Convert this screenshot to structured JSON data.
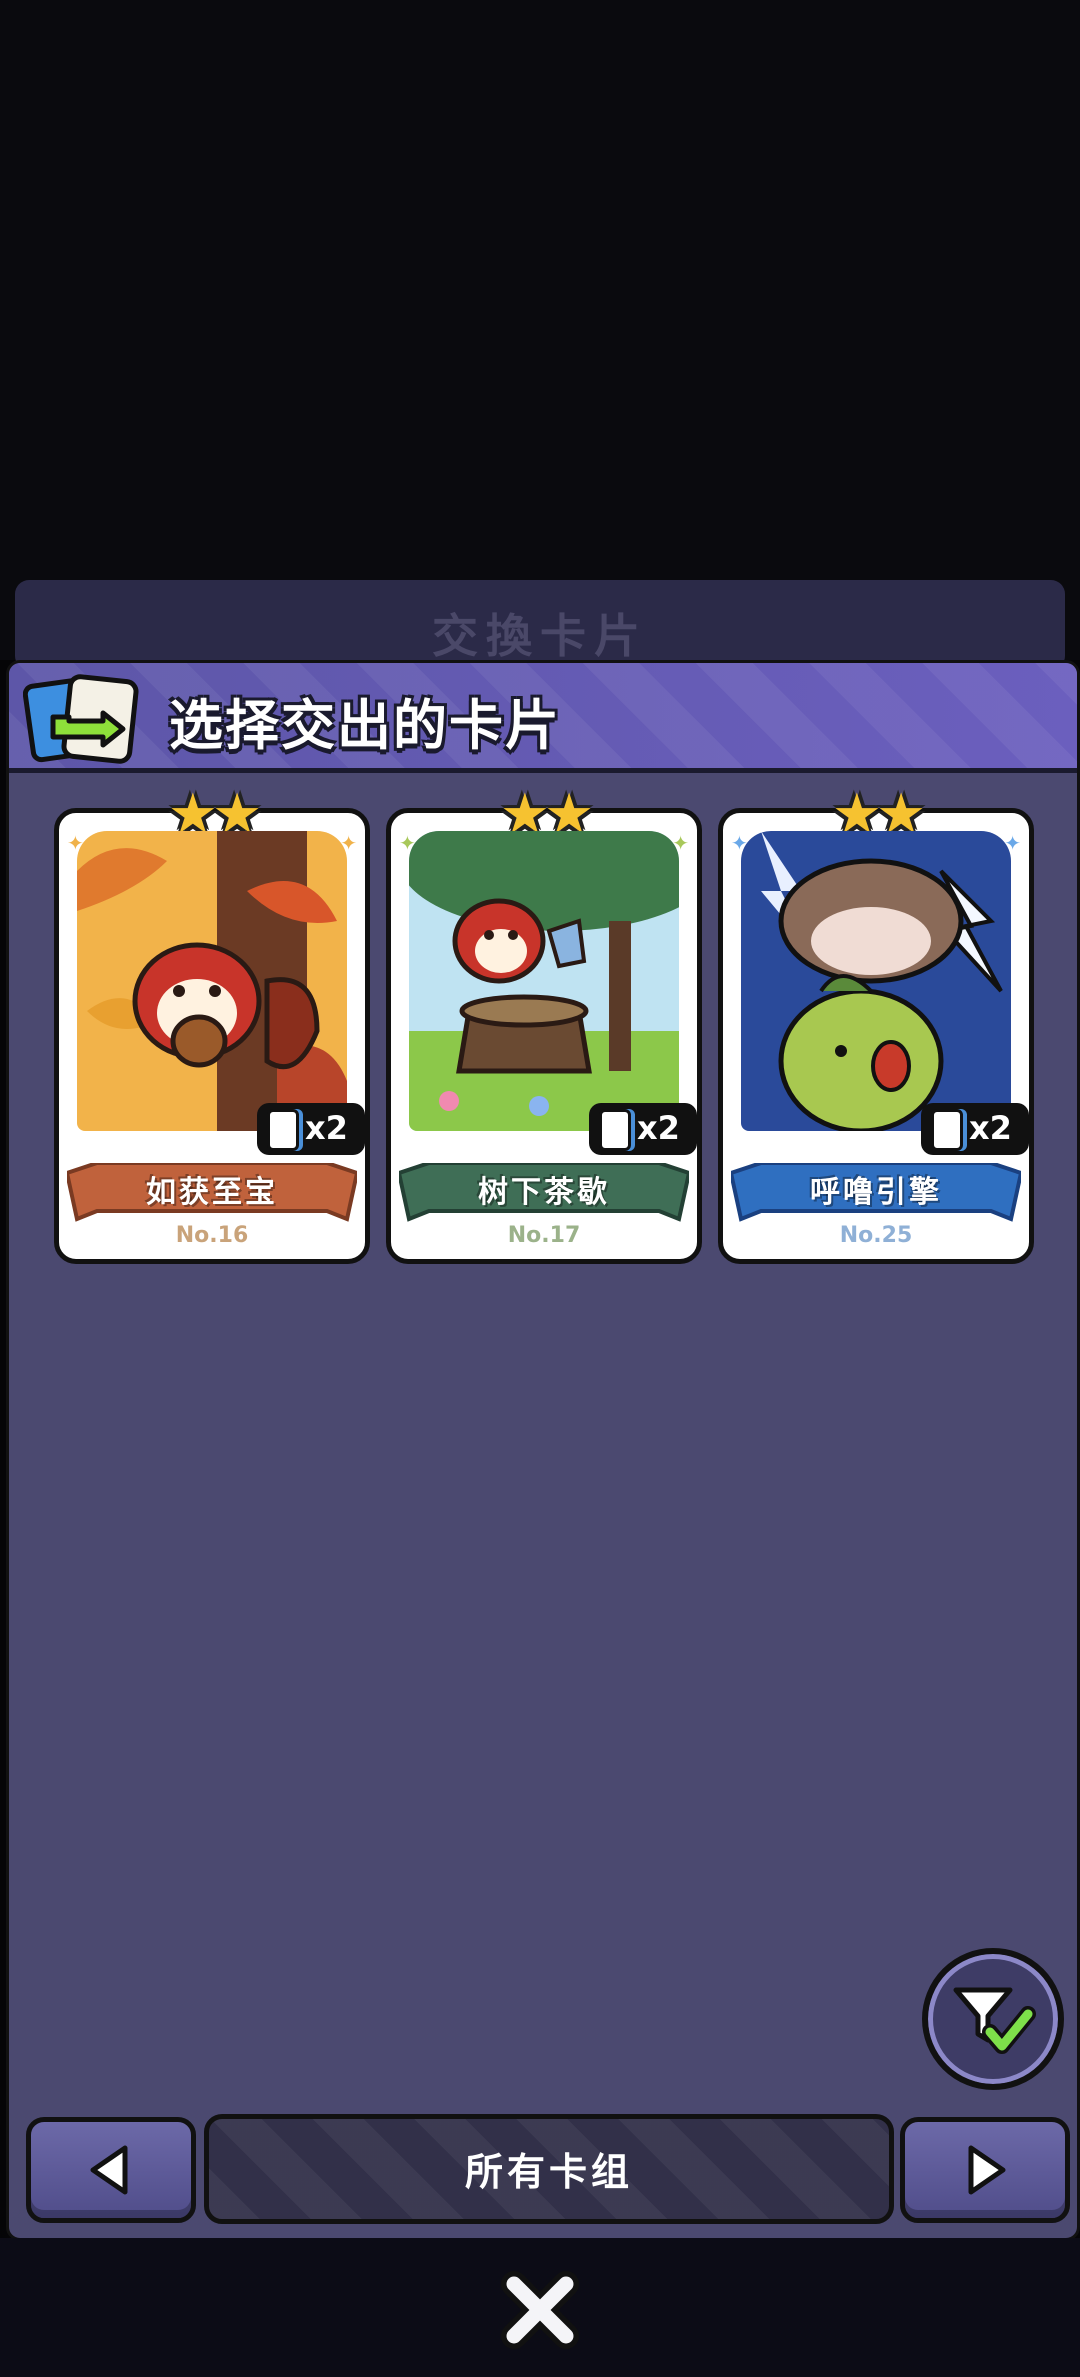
{
  "background": {
    "ghost_title": "交換卡片"
  },
  "header": {
    "title": "选择交出的卡片",
    "icon": "card-exchange-icon"
  },
  "cards": [
    {
      "name": "如获至宝",
      "number": "No.16",
      "count": "x2",
      "stars": "★★",
      "theme_color": "#c0623c",
      "number_color": "#c9a37a"
    },
    {
      "name": "树下茶歇",
      "number": "No.17",
      "count": "x2",
      "stars": "★★",
      "theme_color": "#3f6e56",
      "number_color": "#9bb28a"
    },
    {
      "name": "呼噜引擎",
      "number": "No.25",
      "count": "x2",
      "stars": "★★",
      "theme_color": "#2f6fc0",
      "number_color": "#8fb0d6"
    }
  ],
  "footer": {
    "deck_label": "所有卡组",
    "prev_icon": "triangle-left-icon",
    "next_icon": "triangle-right-icon",
    "filter_icon": "filter-check-icon",
    "close_icon": "close-icon"
  }
}
